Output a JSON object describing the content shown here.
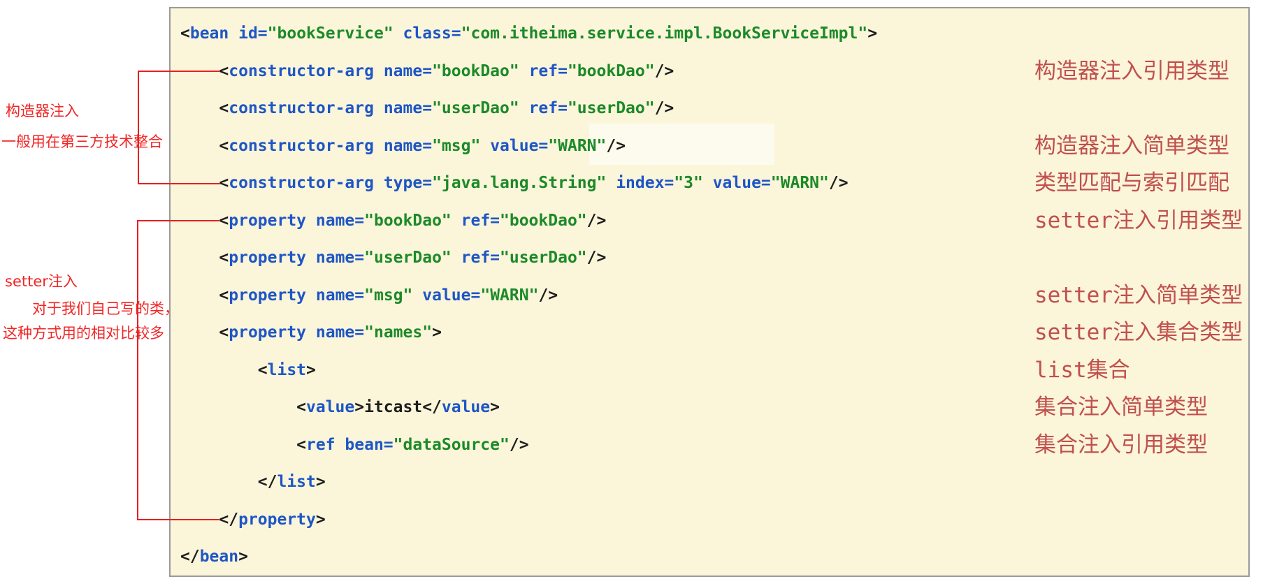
{
  "colors": {
    "code_background": "#fbf5da",
    "code_border": "#9a9a9a",
    "xml_plain_black": "#1d1d1d",
    "xml_name_blue": "#1e56c5",
    "xml_value_green": "#1c8a28",
    "right_label_red": "#c0504d",
    "annotation_red": "#f22525",
    "bracket_red": "#e42020"
  },
  "code": {
    "lines": [
      [
        [
          "p",
          "<"
        ],
        [
          "n",
          "bean"
        ],
        [
          "p",
          " "
        ],
        [
          "n",
          "id="
        ],
        [
          "v",
          "\"bookService\""
        ],
        [
          "p",
          " "
        ],
        [
          "n",
          "class="
        ],
        [
          "v",
          "\"com.itheima.service.impl.BookServiceImpl\""
        ],
        [
          "p",
          ">"
        ]
      ],
      [
        [
          "p",
          "    <"
        ],
        [
          "n",
          "constructor-arg"
        ],
        [
          "p",
          " "
        ],
        [
          "n",
          "name="
        ],
        [
          "v",
          "\"bookDao\""
        ],
        [
          "p",
          " "
        ],
        [
          "n",
          "ref="
        ],
        [
          "v",
          "\"bookDao\""
        ],
        [
          "p",
          "/>"
        ]
      ],
      [
        [
          "p",
          "    <"
        ],
        [
          "n",
          "constructor-arg"
        ],
        [
          "p",
          " "
        ],
        [
          "n",
          "name="
        ],
        [
          "v",
          "\"userDao\""
        ],
        [
          "p",
          " "
        ],
        [
          "n",
          "ref="
        ],
        [
          "v",
          "\"userDao\""
        ],
        [
          "p",
          "/>"
        ]
      ],
      [
        [
          "p",
          "    <"
        ],
        [
          "n",
          "constructor-arg"
        ],
        [
          "p",
          " "
        ],
        [
          "n",
          "name="
        ],
        [
          "v",
          "\"msg\""
        ],
        [
          "p",
          " "
        ],
        [
          "n",
          "value="
        ],
        [
          "v",
          "\"WARN\""
        ],
        [
          "p",
          "/>"
        ]
      ],
      [
        [
          "p",
          "    <"
        ],
        [
          "n",
          "constructor-arg"
        ],
        [
          "p",
          " "
        ],
        [
          "n",
          "type="
        ],
        [
          "v",
          "\"java.lang.String\""
        ],
        [
          "p",
          " "
        ],
        [
          "n",
          "index="
        ],
        [
          "v",
          "\"3\""
        ],
        [
          "p",
          " "
        ],
        [
          "n",
          "value="
        ],
        [
          "v",
          "\"WARN\""
        ],
        [
          "p",
          "/>"
        ]
      ],
      [
        [
          "p",
          "    <"
        ],
        [
          "n",
          "property"
        ],
        [
          "p",
          " "
        ],
        [
          "n",
          "name="
        ],
        [
          "v",
          "\"bookDao\""
        ],
        [
          "p",
          " "
        ],
        [
          "n",
          "ref="
        ],
        [
          "v",
          "\"bookDao\""
        ],
        [
          "p",
          "/>"
        ]
      ],
      [
        [
          "p",
          "    <"
        ],
        [
          "n",
          "property"
        ],
        [
          "p",
          " "
        ],
        [
          "n",
          "name="
        ],
        [
          "v",
          "\"userDao\""
        ],
        [
          "p",
          " "
        ],
        [
          "n",
          "ref="
        ],
        [
          "v",
          "\"userDao\""
        ],
        [
          "p",
          "/>"
        ]
      ],
      [
        [
          "p",
          "    <"
        ],
        [
          "n",
          "property"
        ],
        [
          "p",
          " "
        ],
        [
          "n",
          "name="
        ],
        [
          "v",
          "\"msg\""
        ],
        [
          "p",
          " "
        ],
        [
          "n",
          "value="
        ],
        [
          "v",
          "\"WARN\""
        ],
        [
          "p",
          "/>"
        ]
      ],
      [
        [
          "p",
          "    <"
        ],
        [
          "n",
          "property"
        ],
        [
          "p",
          " "
        ],
        [
          "n",
          "name="
        ],
        [
          "v",
          "\"names\""
        ],
        [
          "p",
          ">"
        ]
      ],
      [
        [
          "p",
          "        <"
        ],
        [
          "n",
          "list"
        ],
        [
          "p",
          ">"
        ]
      ],
      [
        [
          "p",
          "            <"
        ],
        [
          "n",
          "value"
        ],
        [
          "p",
          ">itcast</"
        ],
        [
          "n",
          "value"
        ],
        [
          "p",
          ">"
        ]
      ],
      [
        [
          "p",
          "            <"
        ],
        [
          "n",
          "ref"
        ],
        [
          "p",
          " "
        ],
        [
          "n",
          "bean="
        ],
        [
          "v",
          "\"dataSource\""
        ],
        [
          "p",
          "/>"
        ]
      ],
      [
        [
          "p",
          "        </"
        ],
        [
          "n",
          "list"
        ],
        [
          "p",
          ">"
        ]
      ],
      [
        [
          "p",
          "    </"
        ],
        [
          "n",
          "property"
        ],
        [
          "p",
          ">"
        ]
      ],
      [
        [
          "p",
          "</"
        ],
        [
          "n",
          "bean"
        ],
        [
          "p",
          ">"
        ]
      ]
    ]
  },
  "right_labels": [
    {
      "line": 2,
      "text": "构造器注入引用类型"
    },
    {
      "line": 4,
      "text": "构造器注入简单类型"
    },
    {
      "line": 5,
      "text": "类型匹配与索引匹配"
    },
    {
      "line": 6,
      "text": "setter注入引用类型"
    },
    {
      "line": 8,
      "text": "setter注入简单类型"
    },
    {
      "line": 9,
      "text": "setter注入集合类型"
    },
    {
      "line": 10,
      "text": "list集合"
    },
    {
      "line": 11,
      "text": "集合注入简单类型"
    },
    {
      "line": 12,
      "text": "集合注入引用类型"
    }
  ],
  "left_annotations": {
    "constructor_injection": {
      "title": "构造器注入",
      "desc": "一般用在第三方技术整合"
    },
    "setter_injection": {
      "title": "setter注入",
      "desc1": "对于我们自己写的类，",
      "desc2": "这种方式用的相对比较多"
    }
  }
}
